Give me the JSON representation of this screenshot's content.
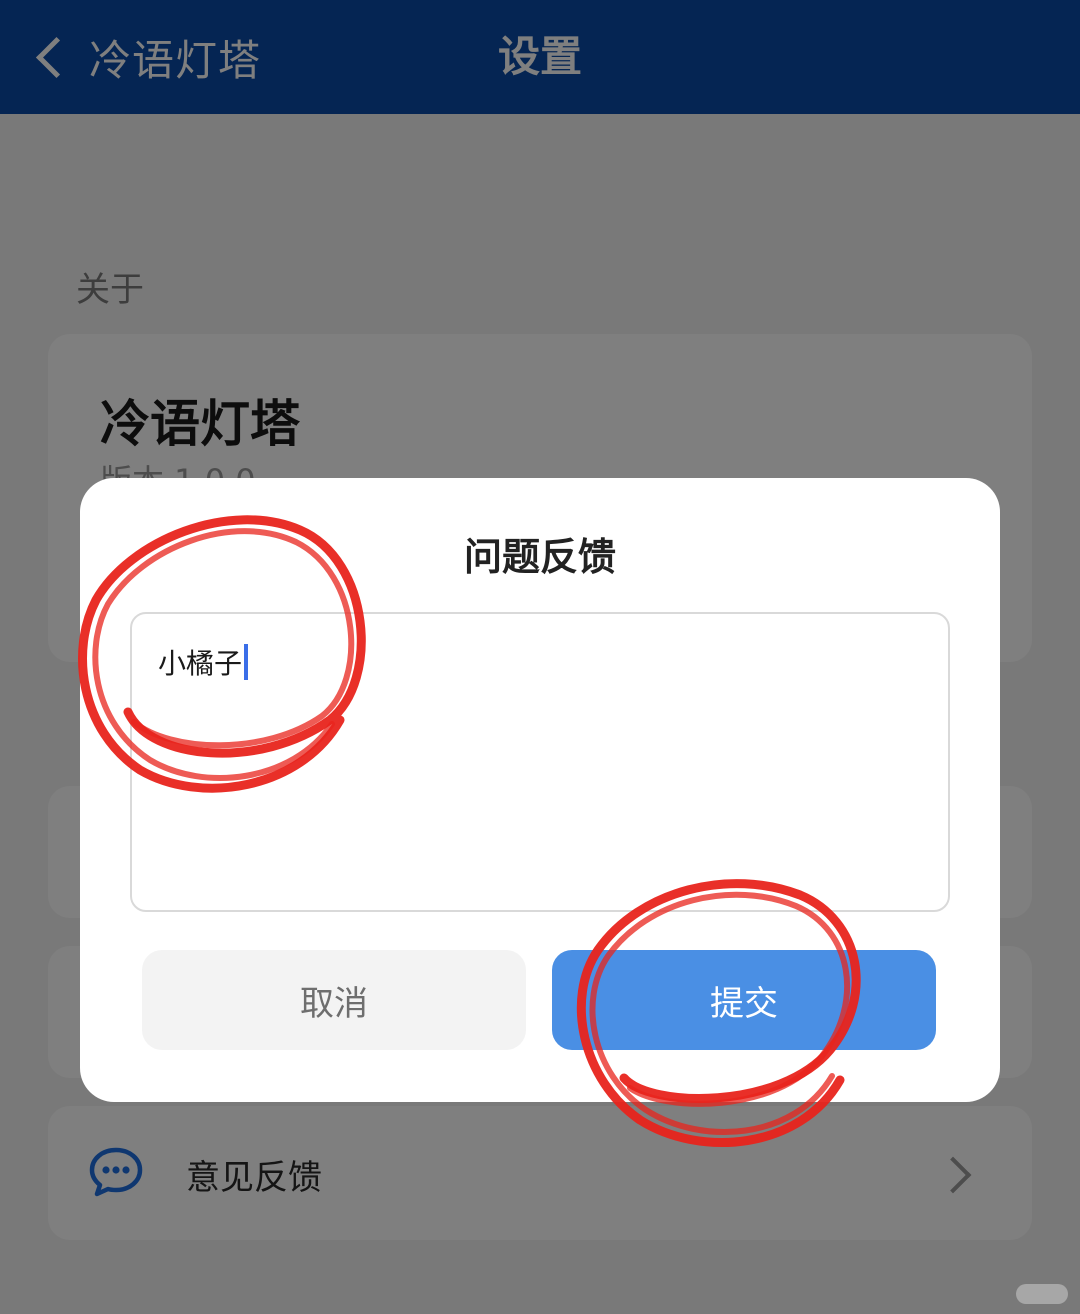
{
  "header": {
    "back_label": "冷语灯塔",
    "title": "设置"
  },
  "about": {
    "section_label": "关于",
    "app_name": "冷语灯塔",
    "version_text": "版本 1.0.0"
  },
  "list": {
    "feedback_label": "意见反馈"
  },
  "dialog": {
    "title": "问题反馈",
    "input_value": "小橘子",
    "cancel_label": "取消",
    "submit_label": "提交"
  },
  "colors": {
    "topbar": "#0a4aa6",
    "submit_button": "#4a8fe4",
    "annotation": "#e8241c",
    "caret": "#3a6ee8"
  },
  "icons": {
    "back": "chevron-left-icon",
    "feedback": "chat-bubble-icon",
    "row_arrow": "chevron-right-icon"
  }
}
